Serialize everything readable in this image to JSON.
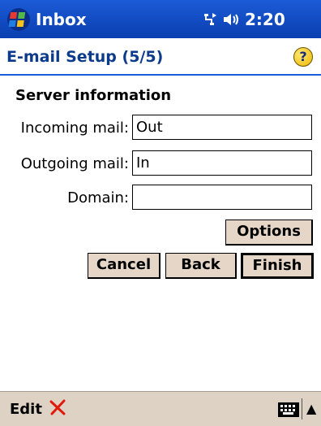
{
  "titlebar": {
    "app_title": "Inbox",
    "time": "2:20",
    "status_icons": [
      "connectivity-icon",
      "speaker-icon"
    ]
  },
  "header": {
    "page_title": "E-mail Setup (5/5)",
    "help_icon": "help-icon"
  },
  "form": {
    "section_title": "Server information",
    "incoming_label": "Incoming mail:",
    "incoming_value": "Out",
    "outgoing_label": "Outgoing mail:",
    "outgoing_value": "In",
    "domain_label": "Domain:",
    "domain_value": ""
  },
  "buttons": {
    "options": "Options",
    "cancel": "Cancel",
    "back": "Back",
    "finish": "Finish"
  },
  "menubar": {
    "edit": "Edit",
    "delete_icon": "delete-x-icon",
    "keyboard_icon": "keyboard-icon",
    "arrow_icon": "arrow-up-icon"
  },
  "colors": {
    "titlebar": "#1b5bd6",
    "header_text": "#0c3b8c",
    "button_bg": "#e6d6c8",
    "menubar_bg": "#ded2c5",
    "delete_x": "#e01a0a"
  }
}
